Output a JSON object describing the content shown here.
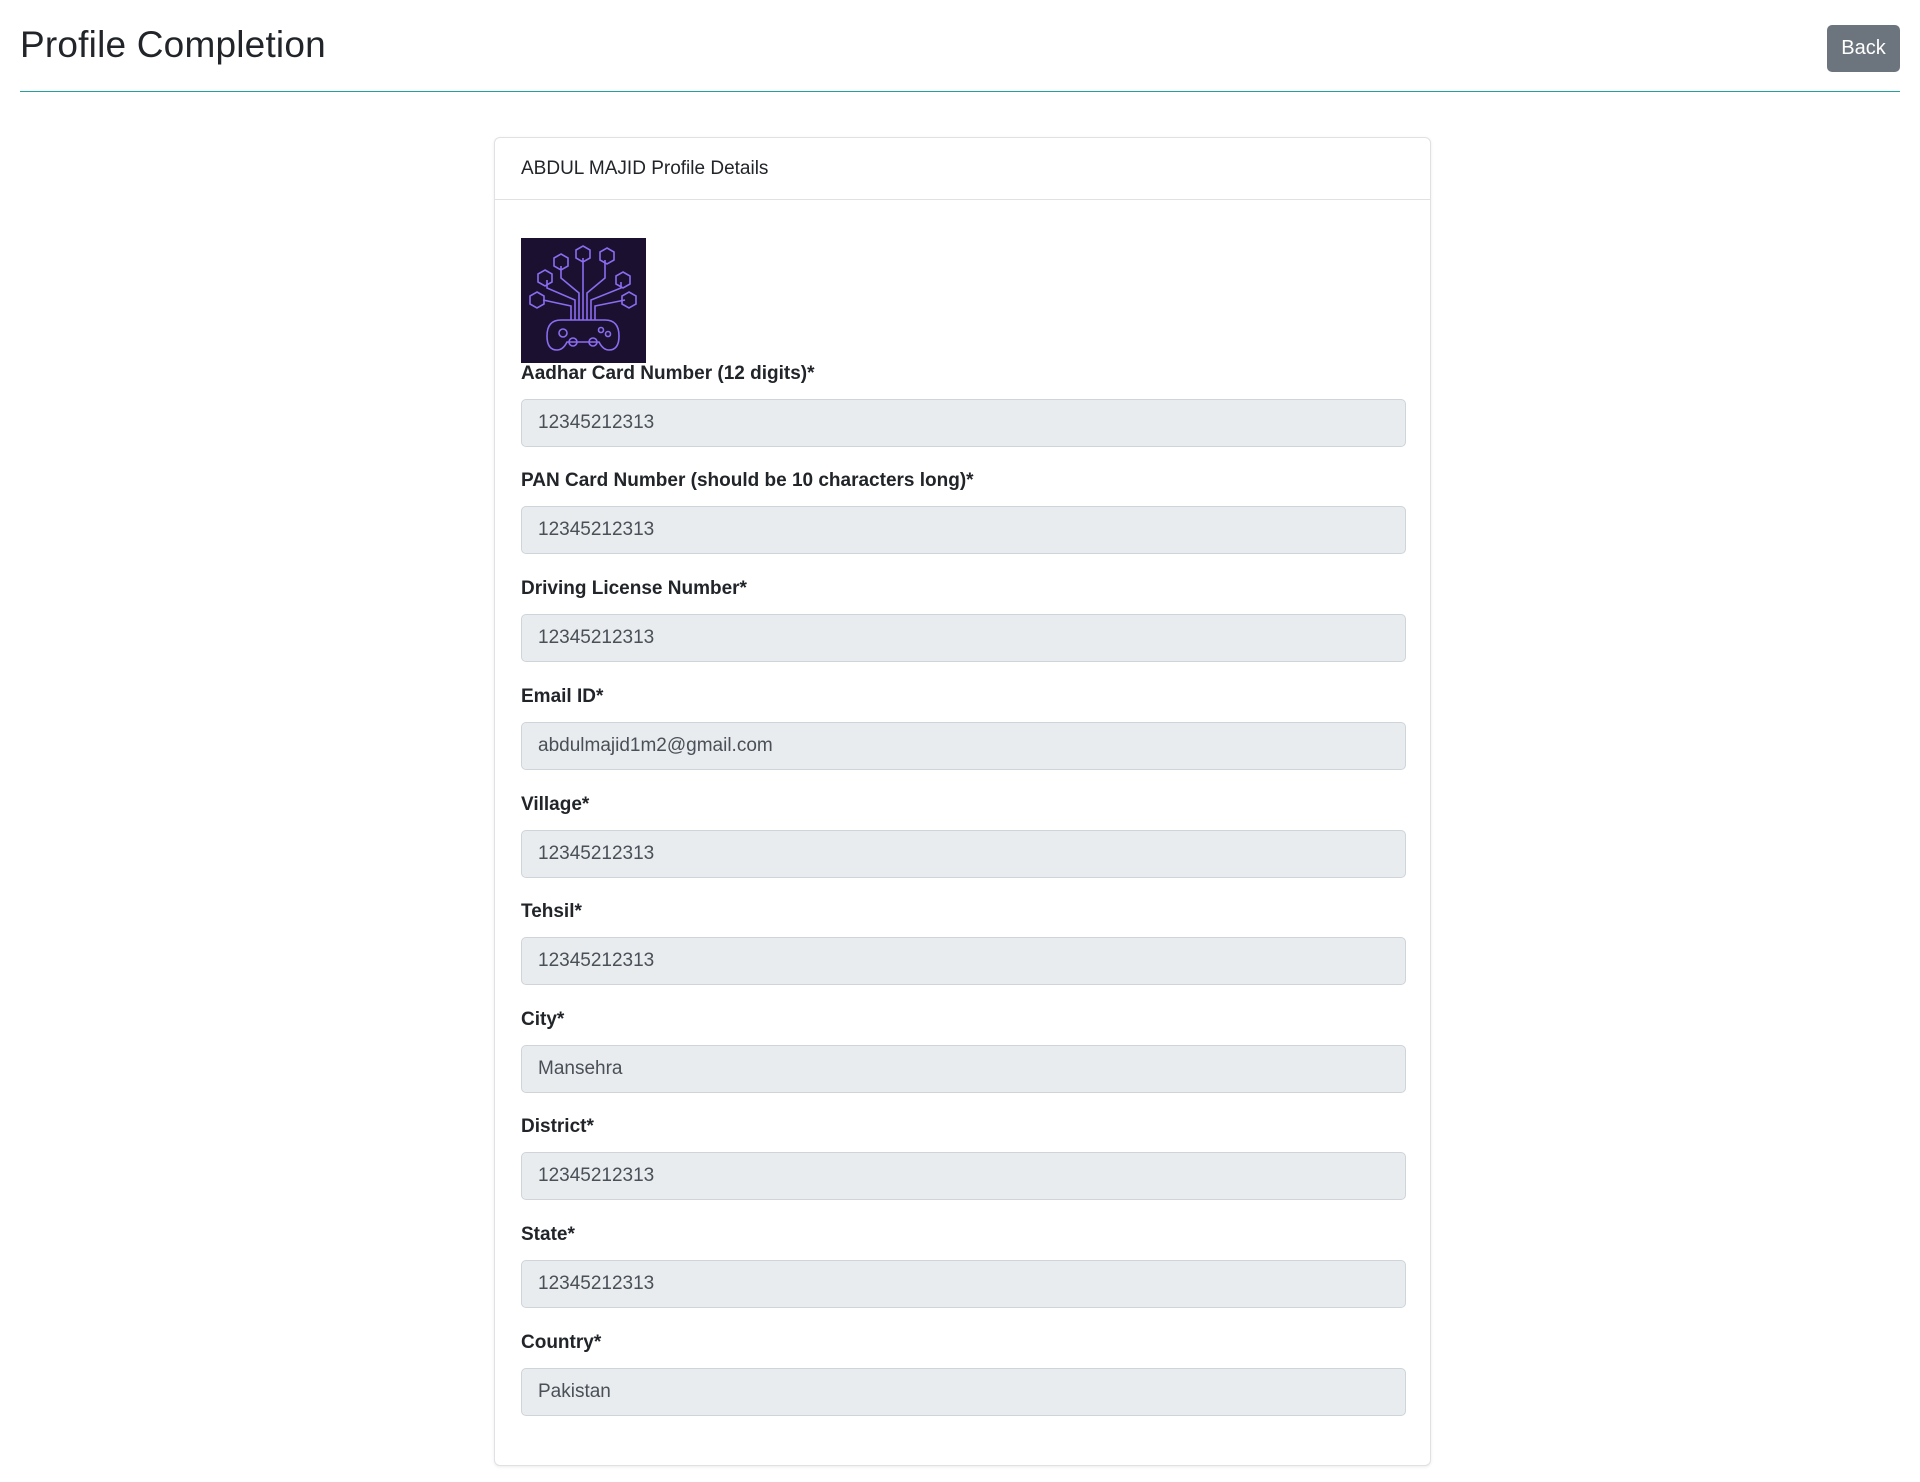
{
  "header": {
    "title": "Profile Completion",
    "back_label": "Back"
  },
  "card": {
    "title": "ABDUL MAJID Profile Details",
    "avatar_icon": "game-controller-circuit-icon",
    "fields": [
      {
        "label": "Aadhar Card Number (12 digits)*",
        "value": "12345212313"
      },
      {
        "label": "PAN Card Number (should be 10 characters long)*",
        "value": "12345212313"
      },
      {
        "label": "Driving License Number*",
        "value": "12345212313"
      },
      {
        "label": "Email ID*",
        "value": "abdulmajid1m2@gmail.com"
      },
      {
        "label": "Village*",
        "value": "12345212313"
      },
      {
        "label": "Tehsil*",
        "value": "12345212313"
      },
      {
        "label": "City*",
        "value": "Mansehra"
      },
      {
        "label": "District*",
        "value": "12345212313"
      },
      {
        "label": "State*",
        "value": "12345212313"
      },
      {
        "label": "Country*",
        "value": "Pakistan"
      }
    ]
  },
  "colors": {
    "accent_rule": "#20a39e",
    "back_button": "#6c757d",
    "input_bg": "#e9ecef"
  }
}
